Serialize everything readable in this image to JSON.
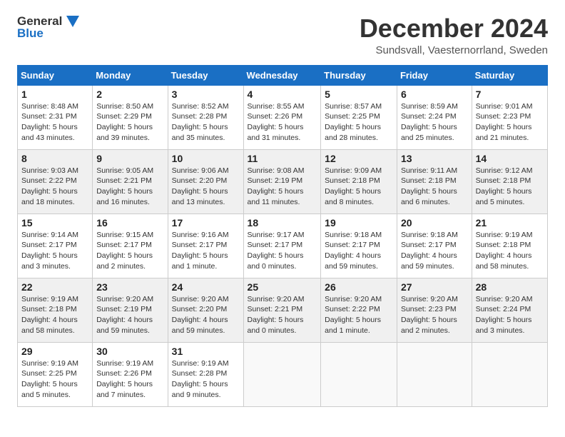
{
  "header": {
    "logo_line1": "General",
    "logo_line2": "Blue",
    "title": "December 2024",
    "subtitle": "Sundsvall, Vaesternorrland, Sweden"
  },
  "days_of_week": [
    "Sunday",
    "Monday",
    "Tuesday",
    "Wednesday",
    "Thursday",
    "Friday",
    "Saturday"
  ],
  "weeks": [
    [
      {
        "day": "1",
        "sunrise": "8:48 AM",
        "sunset": "2:31 PM",
        "daylight": "5 hours and 43 minutes."
      },
      {
        "day": "2",
        "sunrise": "8:50 AM",
        "sunset": "2:29 PM",
        "daylight": "5 hours and 39 minutes."
      },
      {
        "day": "3",
        "sunrise": "8:52 AM",
        "sunset": "2:28 PM",
        "daylight": "5 hours and 35 minutes."
      },
      {
        "day": "4",
        "sunrise": "8:55 AM",
        "sunset": "2:26 PM",
        "daylight": "5 hours and 31 minutes."
      },
      {
        "day": "5",
        "sunrise": "8:57 AM",
        "sunset": "2:25 PM",
        "daylight": "5 hours and 28 minutes."
      },
      {
        "day": "6",
        "sunrise": "8:59 AM",
        "sunset": "2:24 PM",
        "daylight": "5 hours and 25 minutes."
      },
      {
        "day": "7",
        "sunrise": "9:01 AM",
        "sunset": "2:23 PM",
        "daylight": "5 hours and 21 minutes."
      }
    ],
    [
      {
        "day": "8",
        "sunrise": "9:03 AM",
        "sunset": "2:22 PM",
        "daylight": "5 hours and 18 minutes."
      },
      {
        "day": "9",
        "sunrise": "9:05 AM",
        "sunset": "2:21 PM",
        "daylight": "5 hours and 16 minutes."
      },
      {
        "day": "10",
        "sunrise": "9:06 AM",
        "sunset": "2:20 PM",
        "daylight": "5 hours and 13 minutes."
      },
      {
        "day": "11",
        "sunrise": "9:08 AM",
        "sunset": "2:19 PM",
        "daylight": "5 hours and 11 minutes."
      },
      {
        "day": "12",
        "sunrise": "9:09 AM",
        "sunset": "2:18 PM",
        "daylight": "5 hours and 8 minutes."
      },
      {
        "day": "13",
        "sunrise": "9:11 AM",
        "sunset": "2:18 PM",
        "daylight": "5 hours and 6 minutes."
      },
      {
        "day": "14",
        "sunrise": "9:12 AM",
        "sunset": "2:18 PM",
        "daylight": "5 hours and 5 minutes."
      }
    ],
    [
      {
        "day": "15",
        "sunrise": "9:14 AM",
        "sunset": "2:17 PM",
        "daylight": "5 hours and 3 minutes."
      },
      {
        "day": "16",
        "sunrise": "9:15 AM",
        "sunset": "2:17 PM",
        "daylight": "5 hours and 2 minutes."
      },
      {
        "day": "17",
        "sunrise": "9:16 AM",
        "sunset": "2:17 PM",
        "daylight": "5 hours and 1 minute."
      },
      {
        "day": "18",
        "sunrise": "9:17 AM",
        "sunset": "2:17 PM",
        "daylight": "5 hours and 0 minutes."
      },
      {
        "day": "19",
        "sunrise": "9:18 AM",
        "sunset": "2:17 PM",
        "daylight": "4 hours and 59 minutes."
      },
      {
        "day": "20",
        "sunrise": "9:18 AM",
        "sunset": "2:17 PM",
        "daylight": "4 hours and 59 minutes."
      },
      {
        "day": "21",
        "sunrise": "9:19 AM",
        "sunset": "2:18 PM",
        "daylight": "4 hours and 58 minutes."
      }
    ],
    [
      {
        "day": "22",
        "sunrise": "9:19 AM",
        "sunset": "2:18 PM",
        "daylight": "4 hours and 58 minutes."
      },
      {
        "day": "23",
        "sunrise": "9:20 AM",
        "sunset": "2:19 PM",
        "daylight": "4 hours and 59 minutes."
      },
      {
        "day": "24",
        "sunrise": "9:20 AM",
        "sunset": "2:20 PM",
        "daylight": "4 hours and 59 minutes."
      },
      {
        "day": "25",
        "sunrise": "9:20 AM",
        "sunset": "2:21 PM",
        "daylight": "5 hours and 0 minutes."
      },
      {
        "day": "26",
        "sunrise": "9:20 AM",
        "sunset": "2:22 PM",
        "daylight": "5 hours and 1 minute."
      },
      {
        "day": "27",
        "sunrise": "9:20 AM",
        "sunset": "2:23 PM",
        "daylight": "5 hours and 2 minutes."
      },
      {
        "day": "28",
        "sunrise": "9:20 AM",
        "sunset": "2:24 PM",
        "daylight": "5 hours and 3 minutes."
      }
    ],
    [
      {
        "day": "29",
        "sunrise": "9:19 AM",
        "sunset": "2:25 PM",
        "daylight": "5 hours and 5 minutes."
      },
      {
        "day": "30",
        "sunrise": "9:19 AM",
        "sunset": "2:26 PM",
        "daylight": "5 hours and 7 minutes."
      },
      {
        "day": "31",
        "sunrise": "9:19 AM",
        "sunset": "2:28 PM",
        "daylight": "5 hours and 9 minutes."
      },
      null,
      null,
      null,
      null
    ]
  ]
}
